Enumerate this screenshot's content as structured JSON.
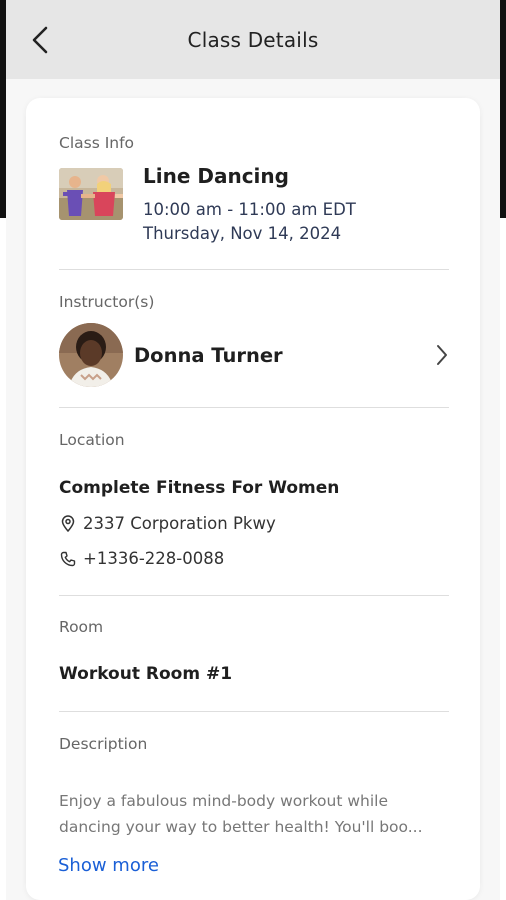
{
  "header": {
    "title": "Class Details"
  },
  "class_info": {
    "label": "Class Info",
    "name": "Line Dancing",
    "time": "10:00 am - 11:00 am EDT",
    "date": "Thursday, Nov 14, 2024"
  },
  "instructors": {
    "label": "Instructor(s)",
    "name": "Donna Turner"
  },
  "location": {
    "label": "Location",
    "name": "Complete Fitness For Women",
    "address": "2337 Corporation Pkwy",
    "phone": "+1336-228-0088"
  },
  "room": {
    "label": "Room",
    "name": "Workout Room #1"
  },
  "description": {
    "label": "Description",
    "line1": "Enjoy a fabulous mind-body workout while",
    "line2": "dancing your way to better health! You'll boo...",
    "show_more": "Show more"
  },
  "colors": {
    "header_bg": "#e6e6e6",
    "link": "#1a5fd6",
    "time_text": "#2f3a56"
  }
}
